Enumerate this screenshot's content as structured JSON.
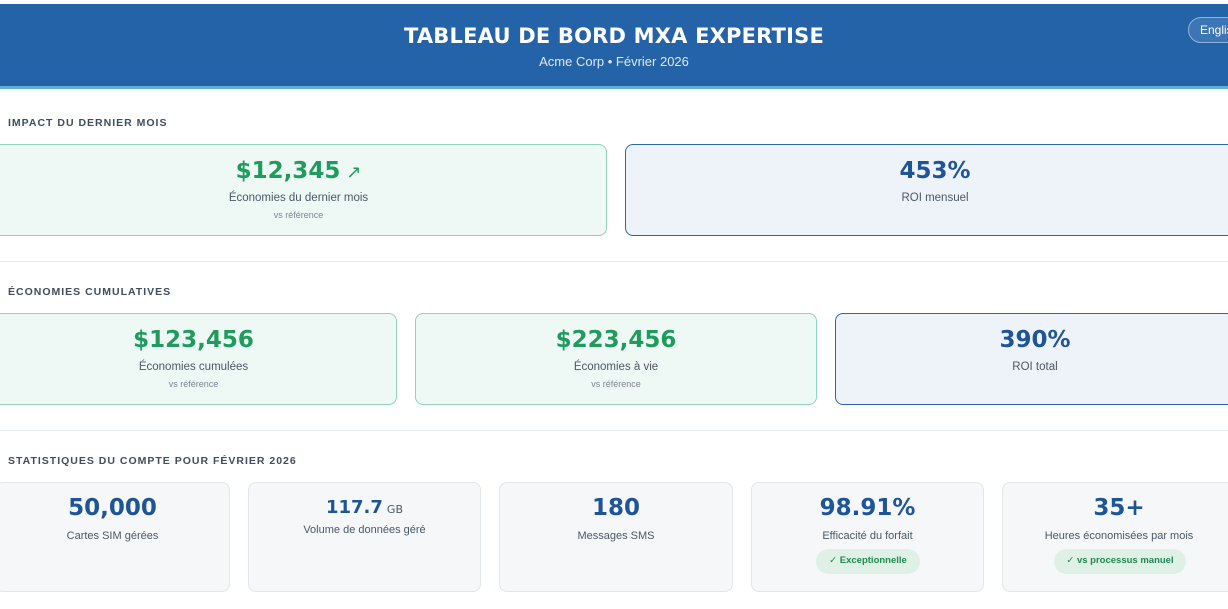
{
  "header": {
    "title": "TABLEAU DE BORD MXA EXPERTISE",
    "subtitle": "Acme Corp • Février 2026",
    "lang_button": "English"
  },
  "impact": {
    "section_title": "IMPACT DU DERNIER MOIS",
    "savings": {
      "value": "$12,345",
      "trend_icon": "trending-up-icon",
      "label": "Économies du dernier mois",
      "note": "vs référence"
    },
    "roi": {
      "value": "453%",
      "label": "ROI mensuel"
    }
  },
  "cumulative": {
    "section_title": "ÉCONOMIES CUMULATIVES",
    "cards": [
      {
        "value": "$123,456",
        "label": "Économies cumulées",
        "note": "vs référence"
      },
      {
        "value": "$223,456",
        "label": "Économies à vie",
        "note": "vs référence"
      },
      {
        "value": "390%",
        "label": "ROI total"
      }
    ]
  },
  "stats": {
    "section_title": "STATISTIQUES DU COMPTE POUR FÉVRIER 2026",
    "items": [
      {
        "value": "50,000",
        "label": "Cartes SIM gérées"
      },
      {
        "value": "117.7",
        "unit": "GB",
        "label": "Volume de données géré"
      },
      {
        "value": "180",
        "label": "Messages SMS"
      },
      {
        "value": "98.91%",
        "label": "Efficacité du forfait",
        "badge": "✓ Exceptionnelle"
      },
      {
        "value": "35+",
        "label": "Heures économisées par mois",
        "badge": "✓ vs processus manuel"
      }
    ]
  },
  "colors": {
    "header_bg": "#2563a8",
    "green_accent": "#1f9b5e",
    "blue_accent": "#1f5596"
  }
}
